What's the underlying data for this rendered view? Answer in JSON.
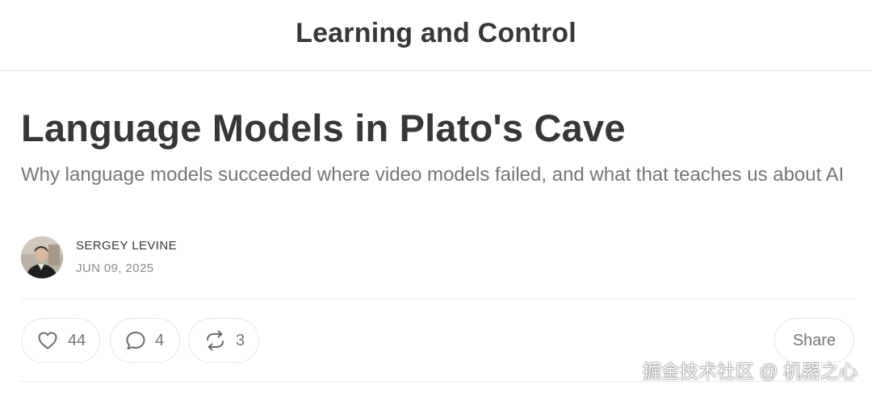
{
  "header": {
    "publication_name": "Learning and Control"
  },
  "post": {
    "title": "Language Models in Plato's Cave",
    "subtitle": "Why language models succeeded where video models failed, and what that teaches us about AI",
    "author": "SERGEY LEVINE",
    "date": "JUN 09, 2025"
  },
  "actions": {
    "likes": {
      "icon": "heart-icon",
      "count": "44"
    },
    "comments": {
      "icon": "comment-icon",
      "count": "4"
    },
    "restacks": {
      "icon": "restack-icon",
      "count": "3"
    },
    "share_label": "Share"
  },
  "watermark": {
    "text": "掘金技术社区 @ 机器之心"
  }
}
